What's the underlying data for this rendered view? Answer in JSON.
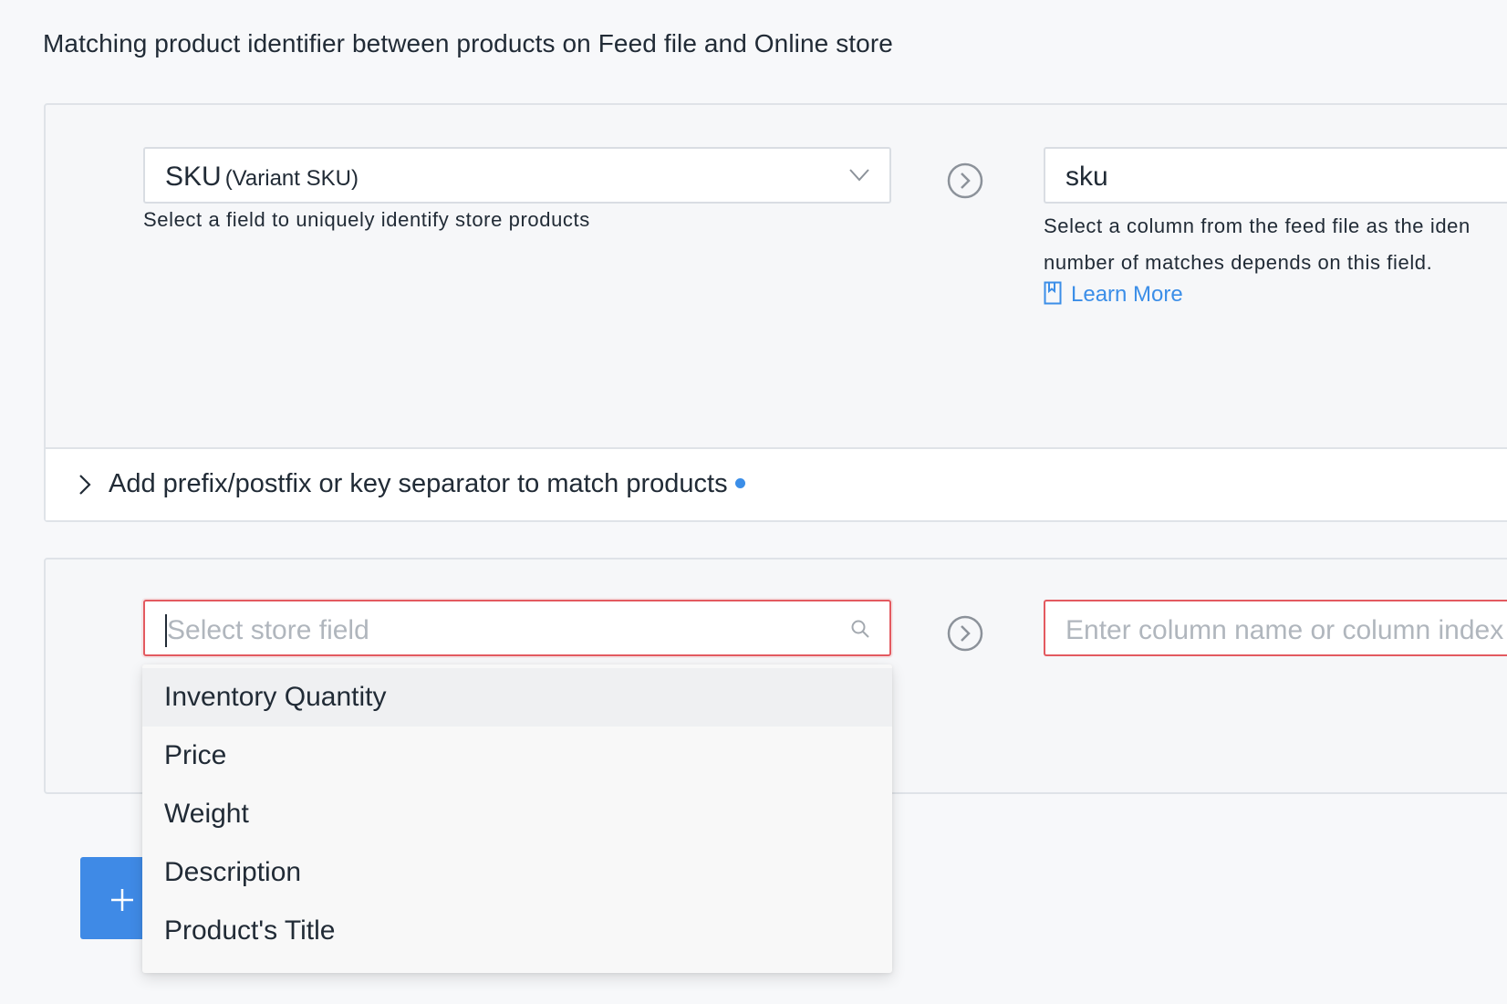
{
  "heading": "Matching product identifier between products on Feed file and Online store",
  "mapping_1": {
    "store_field_value": "SKU",
    "store_field_sub": "(Variant SKU)",
    "store_field_help": "Select a field to uniquely identify store products",
    "feed_column_value": "sku",
    "feed_column_help_line1": "Select a column from the feed file as the iden",
    "feed_column_help_line2": "number of matches depends on this field.",
    "learn_more": "Learn More"
  },
  "advanced_options": {
    "label": "Add prefix/postfix or key separator to match products"
  },
  "mapping_2": {
    "store_field_placeholder": "Select store field",
    "feed_column_placeholder": "Enter column name or column index"
  },
  "dropdown": {
    "items": [
      "Inventory Quantity",
      "Price",
      "Weight",
      "Description",
      "Product's Title"
    ],
    "highlighted_index": 0
  },
  "colors": {
    "accent": "#3b8ee8",
    "button": "#3f8ae6",
    "error_border": "#e35a60",
    "placeholder": "#b0b6bd",
    "text": "#212b36"
  },
  "icons": {
    "select_chevron": "chevron-down-icon",
    "mapping_arrow": "arrow-right-circle-icon",
    "learn_more": "book-icon",
    "search": "search-icon",
    "collapse": "chevron-right-icon",
    "add": "plus-icon"
  }
}
